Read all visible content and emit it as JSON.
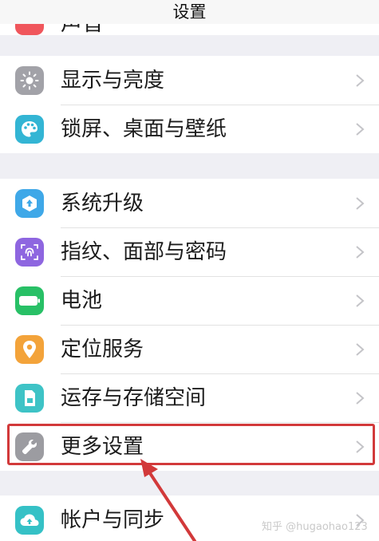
{
  "header": {
    "title": "设置"
  },
  "cut_item": {
    "label": "声音",
    "icon": "sound-icon",
    "color": "#f0565c"
  },
  "group1": {
    "items": [
      {
        "label": "显示与亮度",
        "icon": "sun-icon",
        "color": "#a2a2a8"
      },
      {
        "label": "锁屏、桌面与壁纸",
        "icon": "palette-icon",
        "color": "#33b5d4"
      }
    ]
  },
  "group2": {
    "items": [
      {
        "label": "系统升级",
        "icon": "update-icon",
        "color": "#3fa8e8"
      },
      {
        "label": "指纹、面部与密码",
        "icon": "fingerprint-icon",
        "color": "#8e66e0"
      },
      {
        "label": "电池",
        "icon": "battery-icon",
        "color": "#28c066"
      },
      {
        "label": "定位服务",
        "icon": "location-icon",
        "color": "#f3a33a"
      },
      {
        "label": "运存与存储空间",
        "icon": "storage-icon",
        "color": "#3ec3c6"
      },
      {
        "label": "更多设置",
        "icon": "wrench-icon",
        "color": "#9c9ca1"
      }
    ]
  },
  "group3": {
    "items": [
      {
        "label": "帐户与同步",
        "icon": "cloud-icon",
        "color": "#35c1c6"
      }
    ]
  },
  "annotation": {
    "highlight_color": "#d2393a"
  },
  "watermark": {
    "text": "知乎 @hugaohao123"
  }
}
